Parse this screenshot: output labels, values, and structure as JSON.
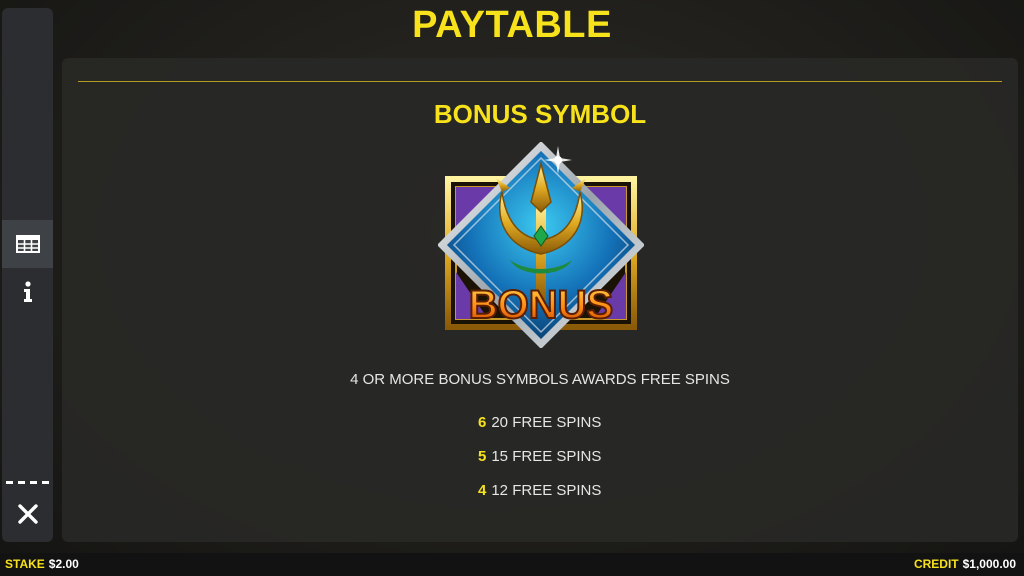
{
  "header": {
    "title": "PAYTABLE"
  },
  "sidebar": {
    "buttons": [
      {
        "icon": "table-icon",
        "active": true
      },
      {
        "icon": "info-icon",
        "active": false
      },
      {
        "icon": "close-icon",
        "active": false
      }
    ]
  },
  "paytable": {
    "section_title": "BONUS SYMBOL",
    "symbol": {
      "icon": "trident-bonus-icon",
      "label": "BONUS"
    },
    "description": "4 OR MORE BONUS SYMBOLS AWARDS FREE SPINS",
    "payouts": [
      {
        "count": "6",
        "reward": "20 FREE SPINS"
      },
      {
        "count": "5",
        "reward": "15 FREE SPINS"
      },
      {
        "count": "4",
        "reward": "12 FREE SPINS"
      }
    ]
  },
  "footer": {
    "stake_label": "STAKE",
    "stake_value": "$2.00",
    "credit_label": "CREDIT",
    "credit_value": "$1,000.00"
  },
  "colors": {
    "accent": "#f7e21b",
    "panel": "#28282699",
    "sidebar": "#2b2d30"
  }
}
